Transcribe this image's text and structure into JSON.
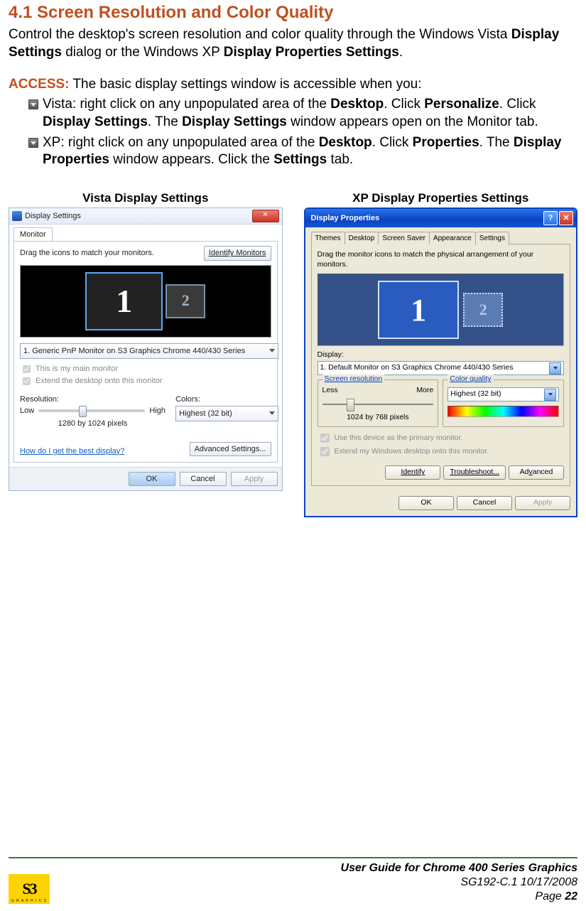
{
  "heading": "4.1   Screen Resolution and Color Quality",
  "intro": {
    "pre": "Control the desktop's screen resolution and color quality through the Windows Vista ",
    "b1": "Display Settings",
    "mid": " dialog or the Windows XP ",
    "b2": "Display Properties Settings",
    "post": "."
  },
  "access_label": "ACCESS:",
  "access_text": " The basic display settings window is accessible when you:",
  "bullets": {
    "vista": {
      "t1": "Vista: right click on any unpopulated area of the ",
      "b1": "Desktop",
      "t2": ". Click ",
      "b2": "Personalize",
      "t3": ". Click ",
      "b3": "Display Settings",
      "t4": ". The ",
      "b4": "Display Settings",
      "t5": " window appears open on the Monitor tab."
    },
    "xp": {
      "t1": "XP: right click on any unpopulated area of the ",
      "b1": "Desktop",
      "t2": ". Click ",
      "b2": "Properties",
      "t3": ". The ",
      "b3": "Display Properties",
      "t4": " window appears. Click the ",
      "b4": "Settings",
      "t5": " tab."
    }
  },
  "vista": {
    "caption": "Vista Display Settings",
    "title": "Display Settings",
    "tab": "Monitor",
    "instruction": "Drag the icons to match your monitors.",
    "identify_btn": "Identify Monitors",
    "mon1": "1",
    "mon2": "2",
    "display_value": "1. Generic PnP Monitor on S3 Graphics Chrome 440/430 Series",
    "chk_main": "This is my main monitor",
    "chk_extend": "Extend the desktop onto this monitor",
    "res_label": "Resolution:",
    "res_low": "Low",
    "res_high": "High",
    "res_value": "1280 by 1024 pixels",
    "colors_label": "Colors:",
    "colors_value": "Highest (32 bit)",
    "link": "How do I get the best display?",
    "adv_btn": "Advanced Settings...",
    "ok": "OK",
    "cancel": "Cancel",
    "apply": "Apply"
  },
  "xp": {
    "caption": "XP Display Properties Settings",
    "title": "Display Properties",
    "tabs": [
      "Themes",
      "Desktop",
      "Screen Saver",
      "Appearance",
      "Settings"
    ],
    "instruction": "Drag the monitor icons to match the physical arrangement of your monitors.",
    "mon1": "1",
    "mon2": "2",
    "display_label": "Display:",
    "display_value": "1. Default Monitor on S3 Graphics Chrome 440/430 Series",
    "sr_group": "Screen resolution",
    "sr_less": "Less",
    "sr_more": "More",
    "sr_value": "1024 by 768 pixels",
    "cq_group": "Color quality",
    "cq_value": "Highest (32 bit)",
    "chk_primary": "Use this device as the primary monitor.",
    "chk_extend": "Extend my Windows desktop onto this monitor.",
    "identify": "Identify",
    "troubleshoot": "Troubleshoot...",
    "advanced": "Advanced",
    "ok": "OK",
    "cancel": "Cancel",
    "apply": "Apply"
  },
  "footer": {
    "title": "User Guide for Chrome 400 Series Graphics",
    "line2": "SG192-C.1   10/17/2008",
    "line3": "Page 22",
    "logo_main": "S3",
    "logo_sub": "G R A P H I C S"
  }
}
